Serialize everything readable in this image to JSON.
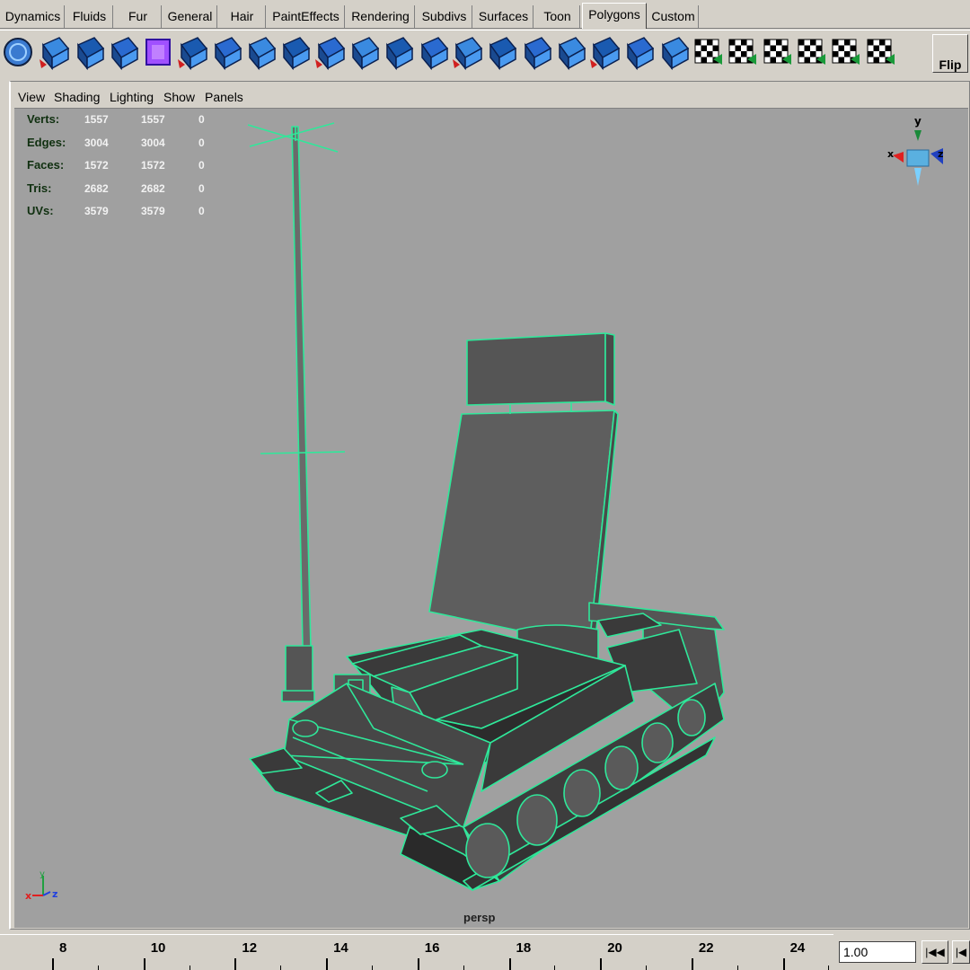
{
  "shelf": {
    "tabs": [
      "Dynamics",
      "Fluids",
      "Fur",
      "General",
      "Hair",
      "PaintEffects",
      "Rendering",
      "Subdivs",
      "Surfaces",
      "Toon",
      "Polygons",
      "Custom"
    ],
    "active_tab": "Polygons",
    "icons": [
      "sphere-icon",
      "extrude-icon",
      "split-icon",
      "combine-icon",
      "cube-icon",
      "plane-icon",
      "cut-icon",
      "bevel-icon",
      "face-icon",
      "wedge-icon",
      "poke-icon",
      "duplicate-icon",
      "subdivide-icon",
      "merge-icon",
      "triangulate-icon",
      "quadrangulate-icon",
      "collapse-icon",
      "split-edge-icon",
      "smooth-icon",
      "normal-icon",
      "uv-planar-icon",
      "uv-cylindrical-icon",
      "uv-spherical-icon",
      "uv-auto-icon",
      "uv-editor-icon",
      "uv-layout-icon"
    ],
    "flip_label": "Flip"
  },
  "panel": {
    "menu": [
      "View",
      "Shading",
      "Lighting",
      "Show",
      "Panels"
    ],
    "camera_label": "persp"
  },
  "hud": {
    "rows": [
      {
        "label": "Verts:",
        "v1": "1557",
        "v2": "1557",
        "v3": "0"
      },
      {
        "label": "Edges:",
        "v1": "3004",
        "v2": "3004",
        "v3": "0"
      },
      {
        "label": "Faces:",
        "v1": "1572",
        "v2": "1572",
        "v3": "0"
      },
      {
        "label": "Tris:",
        "v1": "2682",
        "v2": "2682",
        "v3": "0"
      },
      {
        "label": "UVs:",
        "v1": "3579",
        "v2": "3579",
        "v3": "0"
      }
    ]
  },
  "view_cube": {
    "x": "x",
    "y": "y",
    "z": "z"
  },
  "axis_gizmo": {
    "x": "x",
    "y": "y",
    "z": "z"
  },
  "colors": {
    "wireframe": "#2fe89a",
    "viewport_bg": "#a0a0a0",
    "face": "#5a5a5a"
  },
  "timeline": {
    "labels": [
      "8",
      "10",
      "12",
      "14",
      "16",
      "18",
      "20",
      "22",
      "24"
    ],
    "current_frame": "1.00",
    "playback": {
      "rewind": "|◀◀",
      "step_back": "|◀"
    }
  }
}
